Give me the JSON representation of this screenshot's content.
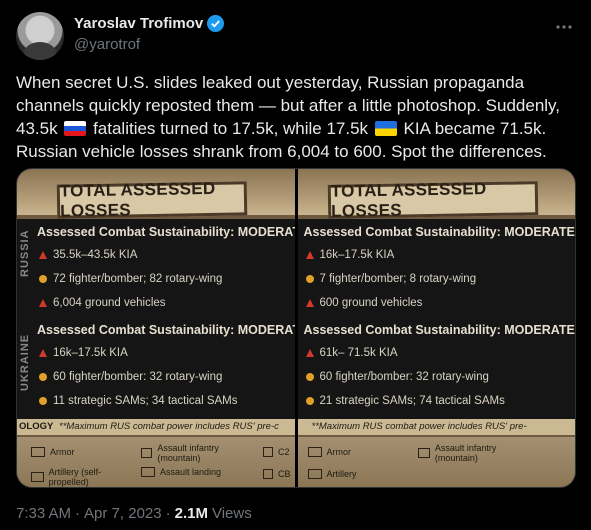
{
  "author": {
    "name": "Yaroslav Trofimov",
    "handle": "@yarotrof"
  },
  "tweet": {
    "text_1": "When secret U.S. slides leaked out yesterday, Russian propaganda channels quickly reposted them — but after a little photoshop. Suddenly, 43.5k",
    "text_2": "fatalities turned to 17.5k, while 17.5k",
    "text_3": "KIA became 71.5k. Russian vehicle losses shrank from 6,004 to 600. Spot the differences."
  },
  "photos": [
    {
      "title": "TOTAL ASSESSED LOSSES",
      "russia_label": "RUSSIA",
      "ukraine_label": "UKRAINE",
      "ru_heading": "Assessed Combat Sustainability: MODERATE",
      "ru_rows": [
        "35.5k–43.5k KIA",
        "72 fighter/bomber; 82 rotary-wing",
        "6,004 ground vehicles"
      ],
      "ua_heading": "Assessed Combat Sustainability: MODERATE",
      "ua_rows": [
        "16k–17.5k KIA",
        "60 fighter/bomber: 32 rotary-wing",
        "11 strategic SAMs; 34 tactical SAMs"
      ],
      "note_prefix": "OLOGY",
      "note": "**Maximum RUS combat power includes RUS' pre-c",
      "legend": [
        "Armor",
        "Assault infantry (mountain)",
        "C2",
        "Artillery (self-propelled)",
        "Assault landing",
        "CB"
      ]
    },
    {
      "title": "TOTAL ASSESSED LOSSES",
      "ru_heading": "Assessed Combat Sustainability: MODERATE",
      "ru_rows": [
        "16k–17.5k KIA",
        "7 fighter/bomber; 8 rotary-wing",
        "600 ground vehicles"
      ],
      "ua_heading": "Assessed Combat Sustainability: MODERATE",
      "ua_rows": [
        "61k– 71.5k KIA",
        "60 fighter/bomber: 32 rotary-wing",
        "21 strategic SAMs; 74 tactical SAMs"
      ],
      "note": "**Maximum RUS combat power includes RUS' pre-",
      "legend": [
        "Armor",
        "Assault infantry (mountain)",
        "Artillery"
      ]
    }
  ],
  "meta": {
    "time": "7:33 AM",
    "sep1": "·",
    "date": "Apr 7, 2023",
    "sep2": "·",
    "views_count": "2.1M",
    "views_label": "Views"
  },
  "colors": {
    "verified": "#1d9bf0",
    "secondary_text": "#71767b",
    "background": "#000000"
  }
}
